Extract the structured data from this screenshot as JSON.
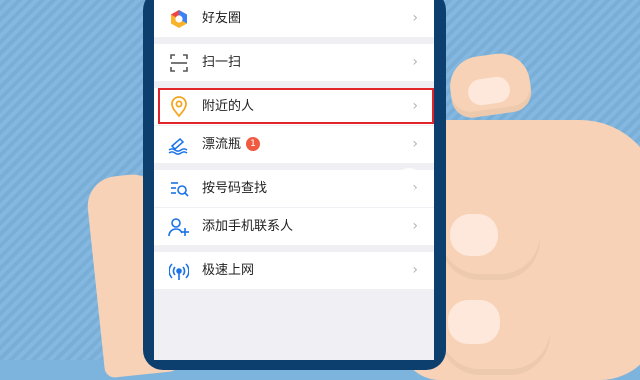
{
  "menu": {
    "items": [
      {
        "label": "好友圈",
        "icon": "friends-circle-icon"
      },
      {
        "label": "扫一扫",
        "icon": "scan-icon"
      },
      {
        "label": "附近的人",
        "icon": "location-pin-icon"
      },
      {
        "label": "漂流瓶",
        "icon": "drift-bottle-icon",
        "badge": "1"
      },
      {
        "label": "按号码查找",
        "icon": "search-list-icon"
      },
      {
        "label": "添加手机联系人",
        "icon": "add-contact-icon"
      },
      {
        "label": "极速上网",
        "icon": "wifi-signal-icon"
      }
    ],
    "chevron": "›"
  },
  "highlighted_item": "附近的人",
  "colors": {
    "accent_blue": "#1a73e8",
    "highlight_red": "#e0262a",
    "badge_red": "#f05a41",
    "pin_orange": "#f5a623"
  }
}
